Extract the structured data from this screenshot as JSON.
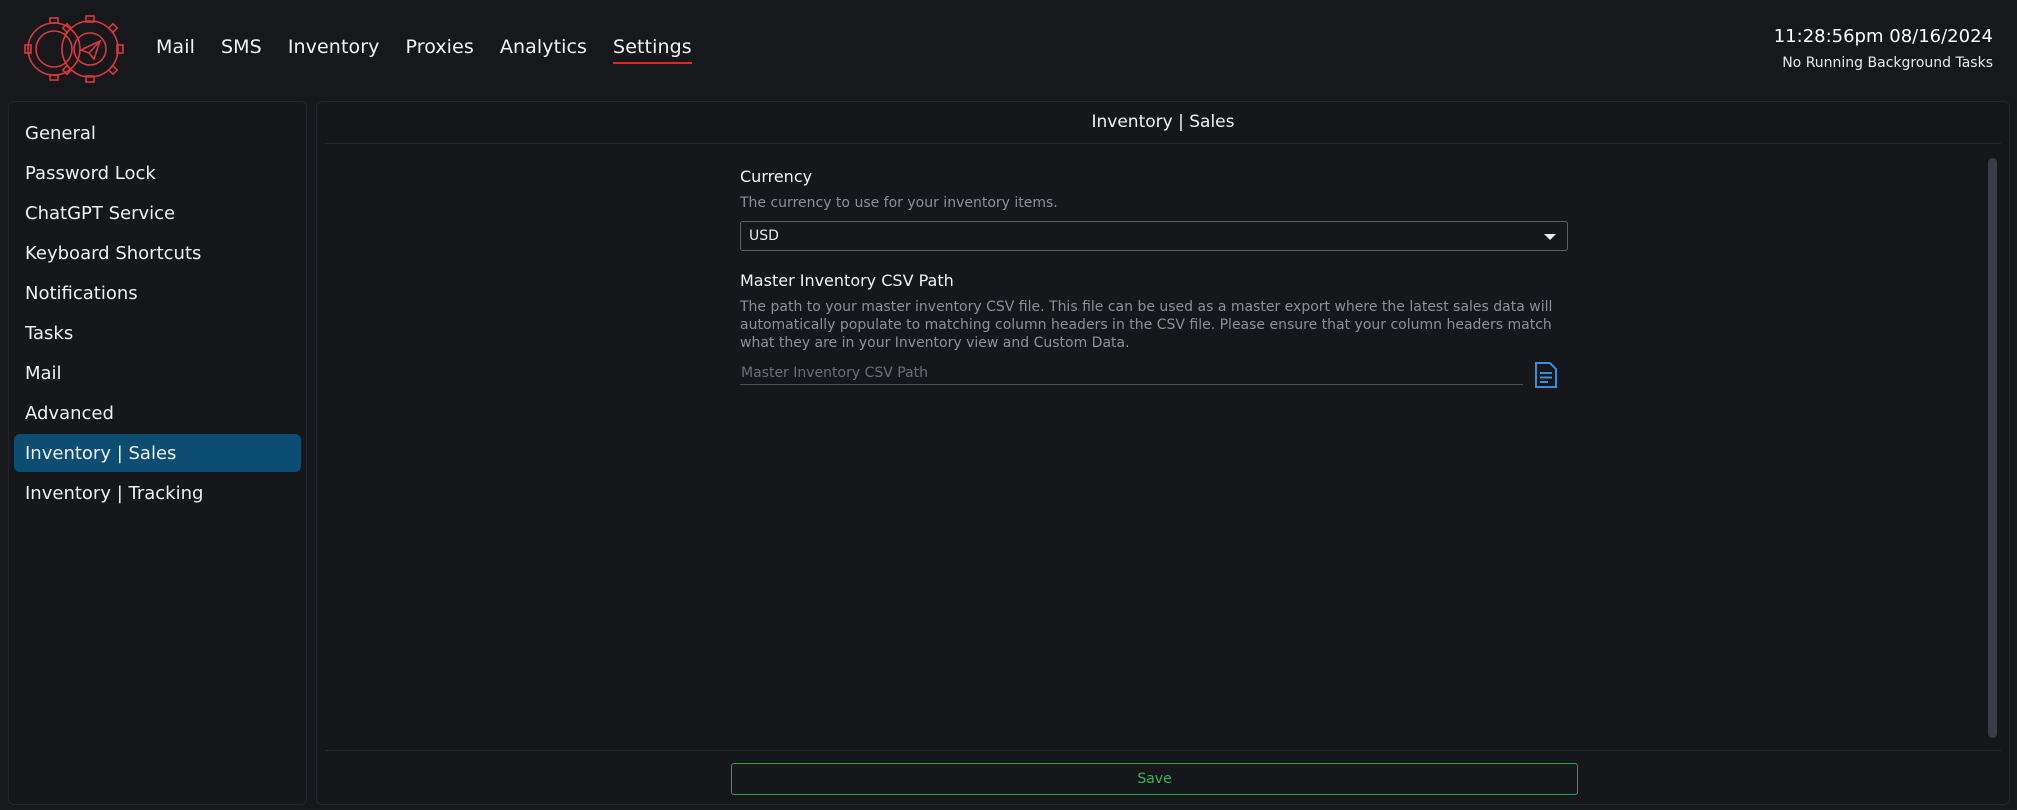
{
  "header": {
    "logo_icon": "paper-plane-gear-logo",
    "nav": [
      {
        "label": "Mail",
        "active": false
      },
      {
        "label": "SMS",
        "active": false
      },
      {
        "label": "Inventory",
        "active": false
      },
      {
        "label": "Proxies",
        "active": false
      },
      {
        "label": "Analytics",
        "active": false
      },
      {
        "label": "Settings",
        "active": true
      }
    ],
    "datetime": "11:28:56pm 08/16/2024",
    "background_status": "No Running Background Tasks"
  },
  "sidebar": {
    "items": [
      {
        "label": "General"
      },
      {
        "label": "Password Lock"
      },
      {
        "label": "ChatGPT Service"
      },
      {
        "label": "Keyboard Shortcuts"
      },
      {
        "label": "Notifications"
      },
      {
        "label": "Tasks"
      },
      {
        "label": "Mail"
      },
      {
        "label": "Advanced"
      },
      {
        "label": "Inventory | Sales"
      },
      {
        "label": "Inventory | Tracking"
      }
    ],
    "selected": "Inventory | Sales"
  },
  "main": {
    "title": "Inventory | Sales",
    "currency": {
      "label": "Currency",
      "description": "The currency to use for your inventory items.",
      "value": "USD"
    },
    "csv_path": {
      "label": "Master Inventory CSV Path",
      "description": "The path to your master inventory CSV file. This file can be used as a master export where the latest sales data will automatically populate to matching column headers in the CSV file. Please ensure that your column headers match what they are in your Inventory view and Custom Data.",
      "placeholder": "Master Inventory CSV Path",
      "value": "",
      "icon": "file-document-icon"
    },
    "save_label": "Save"
  },
  "colors": {
    "background": "#16181c",
    "accent_active_nav": "#e0262b",
    "sidebar_selected": "#0e4d72",
    "save_button": "#2aa14b",
    "file_icon": "#3a8fd6"
  }
}
